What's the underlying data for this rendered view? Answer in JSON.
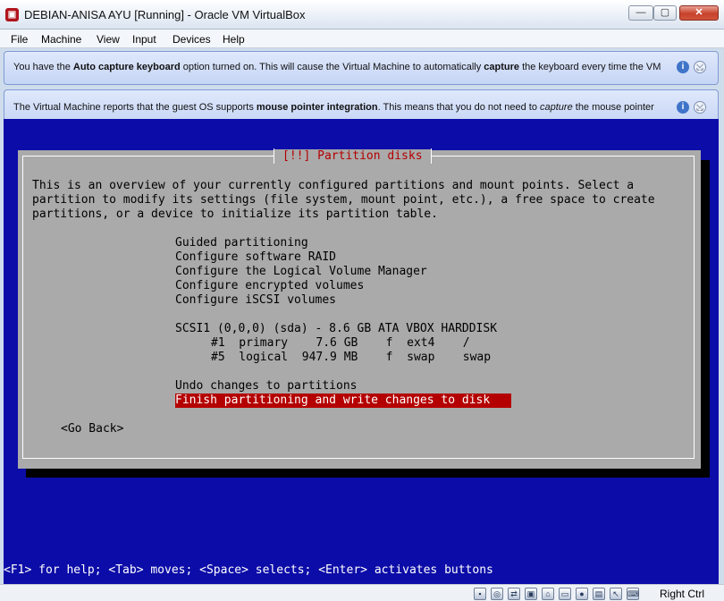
{
  "window": {
    "title": "DEBIAN-ANISA AYU [Running] - Oracle VM VirtualBox",
    "buttons": {
      "minimize": "—",
      "maximize": "▢",
      "close": "✕"
    }
  },
  "menu": {
    "items": [
      "File",
      "Machine",
      "View",
      "Input",
      "Devices",
      "Help"
    ]
  },
  "notifications": [
    {
      "pre": "You have the ",
      "b1": "Auto capture keyboard",
      "mid": " option turned on. This will cause the Virtual Machine to automatically ",
      "b2": "capture",
      "post": " the keyboard every time the VM",
      "info_icon": "i",
      "mute_icon": "⤩"
    },
    {
      "pre": "The Virtual Machine reports that the guest OS supports ",
      "b1": "mouse pointer integration",
      "mid": ". This means that you do not need to ",
      "i1": "capture",
      "post": " the mouse pointer",
      "info_icon": "i",
      "mute_icon": "⤩"
    }
  ],
  "installer": {
    "title": "[!!] Partition disks",
    "description": [
      "This is an overview of your currently configured partitions and mount points. Select a",
      "partition to modify its settings (file system, mount point, etc.), a free space to create",
      "partitions, or a device to initialize its partition table."
    ],
    "options": [
      "Guided partitioning",
      "Configure software RAID",
      "Configure the Logical Volume Manager",
      "Configure encrypted volumes",
      "Configure iSCSI volumes"
    ],
    "disk": "SCSI1 (0,0,0) (sda) - 8.6 GB ATA VBOX HARDDISK",
    "partitions": [
      "#1  primary    7.6 GB    f  ext4    /",
      "#5  logical  947.9 MB    f  swap    swap"
    ],
    "undo": "Undo changes to partitions",
    "finish": "Finish partitioning and write changes to disk",
    "go_back": "<Go Back>",
    "help": "<F1> for help; <Tab> moves; <Space> selects; <Enter> activates buttons"
  },
  "statusbar": {
    "icons": [
      "hdd-icon",
      "optical-drive-icon",
      "usb-icon",
      "network-icon",
      "shared-folder-icon",
      "display-icon",
      "video-capture-icon",
      "cpu-icon",
      "mouse-integration-icon",
      "keyboard-icon"
    ],
    "glyphs": [
      "▪",
      "◎",
      "⇄",
      "▣",
      "⌂",
      "▭",
      "●",
      "▤",
      "↖",
      "⌨"
    ],
    "host_key": "Right Ctrl"
  }
}
